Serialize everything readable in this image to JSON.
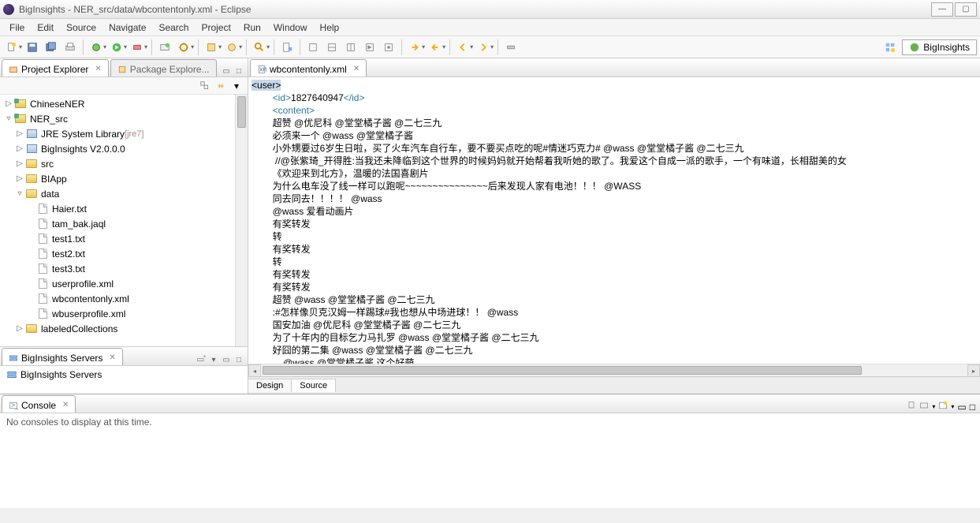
{
  "window": {
    "title": "BigInsights - NER_src/data/wbcontentonly.xml - Eclipse"
  },
  "menubar": [
    "File",
    "Edit",
    "Source",
    "Navigate",
    "Search",
    "Project",
    "Run",
    "Window",
    "Help"
  ],
  "perspective": {
    "label": "BigInsights"
  },
  "views": {
    "project_explorer": {
      "title": "Project Explorer"
    },
    "package_explorer": {
      "title": "Package Explore..."
    },
    "servers": {
      "title": "BigInsights Servers",
      "root": "BigInsights Servers"
    },
    "console": {
      "title": "Console",
      "message": "No consoles to display at this time."
    }
  },
  "tree": {
    "projects": [
      {
        "name": "ChineseNER",
        "expanded": false
      },
      {
        "name": "NER_src",
        "expanded": true,
        "children": [
          {
            "name": "JRE System Library",
            "decorator": "[jre7]",
            "type": "jar"
          },
          {
            "name": "BigInsights V2.0.0.0",
            "type": "jar"
          },
          {
            "name": "src",
            "type": "folder"
          },
          {
            "name": "BIApp",
            "type": "folder"
          },
          {
            "name": "data",
            "type": "folder",
            "expanded": true,
            "children": [
              {
                "name": "Haier.txt",
                "type": "file"
              },
              {
                "name": "tam_bak.jaql",
                "type": "file"
              },
              {
                "name": "test1.txt",
                "type": "file"
              },
              {
                "name": "test2.txt",
                "type": "file"
              },
              {
                "name": "test3.txt",
                "type": "file"
              },
              {
                "name": "userprofile.xml",
                "type": "file"
              },
              {
                "name": "wbcontentonly.xml",
                "type": "file"
              },
              {
                "name": "wbuserprofile.xml",
                "type": "file"
              }
            ]
          },
          {
            "name": "labeledCollections",
            "type": "folder"
          }
        ]
      }
    ]
  },
  "editor": {
    "tab": "wbcontentonly.xml",
    "bottom_tabs": {
      "design": "Design",
      "source": "Source"
    },
    "lines": [
      {
        "indent": 0,
        "type": "tag",
        "text": "<user>"
      },
      {
        "indent": 2,
        "type": "tagwrap",
        "open": "<id>",
        "body": "1827640947",
        "close": "</id>"
      },
      {
        "indent": 2,
        "type": "tag",
        "text": "<content>"
      },
      {
        "indent": 2,
        "type": "text",
        "text": "超赞 @优尼科 @堂堂橘子酱 @二七三九"
      },
      {
        "indent": 2,
        "type": "text",
        "text": "必须来一个 @wass @堂堂橘子酱"
      },
      {
        "indent": 2,
        "type": "text",
        "text": "小外甥要过6岁生日啦，买了火车汽车自行车，要不要买点吃的呢#情迷巧克力# @wass @堂堂橘子酱 @二七三九"
      },
      {
        "indent": 2,
        "type": "text",
        "text": " //@张紫琦_开得胜:当我还未降临到这个世界的时候妈妈就开始帮着我听她的歌了。我爱这个自成一派的歌手，一个有味道，长相甜美的女"
      },
      {
        "indent": 2,
        "type": "text",
        "text": "《欢迎来到北方》，温暖的法国喜剧片"
      },
      {
        "indent": 2,
        "type": "text",
        "text": "为什么电车没了线一样可以跑呢~~~~~~~~~~~~~~~后来发现人家有电池！！！ @WASS"
      },
      {
        "indent": 2,
        "type": "text",
        "text": "同去同去！！！！ @wass"
      },
      {
        "indent": 2,
        "type": "text",
        "text": "@wass 爱看动画片"
      },
      {
        "indent": 2,
        "type": "text",
        "text": "有奖转发"
      },
      {
        "indent": 2,
        "type": "text",
        "text": "转"
      },
      {
        "indent": 2,
        "type": "text",
        "text": "有奖转发"
      },
      {
        "indent": 2,
        "type": "text",
        "text": "转"
      },
      {
        "indent": 2,
        "type": "text",
        "text": "有奖转发"
      },
      {
        "indent": 2,
        "type": "text",
        "text": "有奖转发"
      },
      {
        "indent": 2,
        "type": "text",
        "text": "超赞 @wass @堂堂橘子酱 @二七三九"
      },
      {
        "indent": 2,
        "type": "text",
        "text": ":#怎样像贝克汉姆一样踢球#我也想从中场进球！！ @wass"
      },
      {
        "indent": 2,
        "type": "text",
        "text": "国安加油 @优尼科 @堂堂橘子酱 @二七三九"
      },
      {
        "indent": 2,
        "type": "text",
        "text": "为了十年内的目标乞力马扎罗 @wass @堂堂橘子酱 @二七三九"
      },
      {
        "indent": 2,
        "type": "text",
        "text": "好囧的第二集 @wass @堂堂橘子酱 @二七三九"
      },
      {
        "indent": 3,
        "type": "text",
        "text": "@wass @堂堂橘子酱 这个好萌"
      }
    ]
  }
}
